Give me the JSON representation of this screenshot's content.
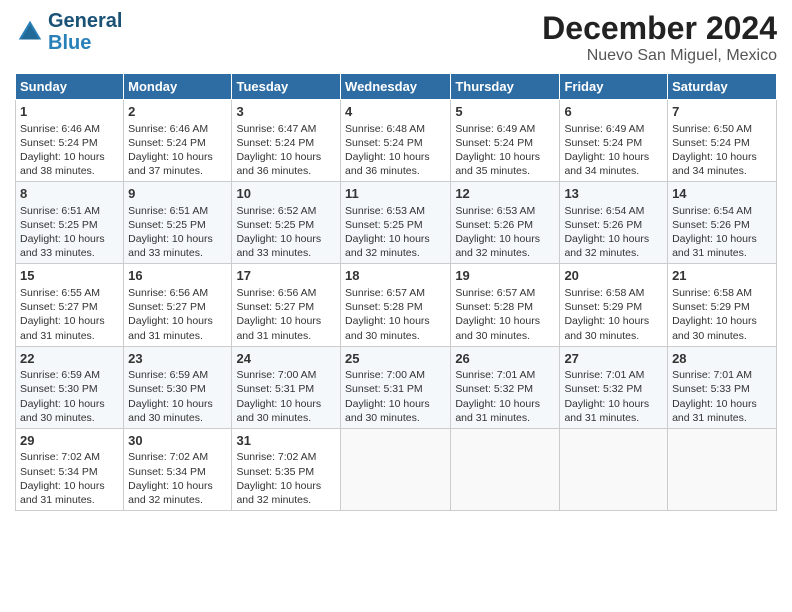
{
  "header": {
    "logo_line1": "General",
    "logo_line2": "Blue",
    "month": "December 2024",
    "location": "Nuevo San Miguel, Mexico"
  },
  "days_of_week": [
    "Sunday",
    "Monday",
    "Tuesday",
    "Wednesday",
    "Thursday",
    "Friday",
    "Saturday"
  ],
  "weeks": [
    [
      {
        "day": 1,
        "sunrise": "6:46 AM",
        "sunset": "5:24 PM",
        "daylight": "10 hours and 38 minutes."
      },
      {
        "day": 2,
        "sunrise": "6:46 AM",
        "sunset": "5:24 PM",
        "daylight": "10 hours and 37 minutes."
      },
      {
        "day": 3,
        "sunrise": "6:47 AM",
        "sunset": "5:24 PM",
        "daylight": "10 hours and 36 minutes."
      },
      {
        "day": 4,
        "sunrise": "6:48 AM",
        "sunset": "5:24 PM",
        "daylight": "10 hours and 36 minutes."
      },
      {
        "day": 5,
        "sunrise": "6:49 AM",
        "sunset": "5:24 PM",
        "daylight": "10 hours and 35 minutes."
      },
      {
        "day": 6,
        "sunrise": "6:49 AM",
        "sunset": "5:24 PM",
        "daylight": "10 hours and 34 minutes."
      },
      {
        "day": 7,
        "sunrise": "6:50 AM",
        "sunset": "5:24 PM",
        "daylight": "10 hours and 34 minutes."
      }
    ],
    [
      {
        "day": 8,
        "sunrise": "6:51 AM",
        "sunset": "5:25 PM",
        "daylight": "10 hours and 33 minutes."
      },
      {
        "day": 9,
        "sunrise": "6:51 AM",
        "sunset": "5:25 PM",
        "daylight": "10 hours and 33 minutes."
      },
      {
        "day": 10,
        "sunrise": "6:52 AM",
        "sunset": "5:25 PM",
        "daylight": "10 hours and 33 minutes."
      },
      {
        "day": 11,
        "sunrise": "6:53 AM",
        "sunset": "5:25 PM",
        "daylight": "10 hours and 32 minutes."
      },
      {
        "day": 12,
        "sunrise": "6:53 AM",
        "sunset": "5:26 PM",
        "daylight": "10 hours and 32 minutes."
      },
      {
        "day": 13,
        "sunrise": "6:54 AM",
        "sunset": "5:26 PM",
        "daylight": "10 hours and 32 minutes."
      },
      {
        "day": 14,
        "sunrise": "6:54 AM",
        "sunset": "5:26 PM",
        "daylight": "10 hours and 31 minutes."
      }
    ],
    [
      {
        "day": 15,
        "sunrise": "6:55 AM",
        "sunset": "5:27 PM",
        "daylight": "10 hours and 31 minutes."
      },
      {
        "day": 16,
        "sunrise": "6:56 AM",
        "sunset": "5:27 PM",
        "daylight": "10 hours and 31 minutes."
      },
      {
        "day": 17,
        "sunrise": "6:56 AM",
        "sunset": "5:27 PM",
        "daylight": "10 hours and 31 minutes."
      },
      {
        "day": 18,
        "sunrise": "6:57 AM",
        "sunset": "5:28 PM",
        "daylight": "10 hours and 30 minutes."
      },
      {
        "day": 19,
        "sunrise": "6:57 AM",
        "sunset": "5:28 PM",
        "daylight": "10 hours and 30 minutes."
      },
      {
        "day": 20,
        "sunrise": "6:58 AM",
        "sunset": "5:29 PM",
        "daylight": "10 hours and 30 minutes."
      },
      {
        "day": 21,
        "sunrise": "6:58 AM",
        "sunset": "5:29 PM",
        "daylight": "10 hours and 30 minutes."
      }
    ],
    [
      {
        "day": 22,
        "sunrise": "6:59 AM",
        "sunset": "5:30 PM",
        "daylight": "10 hours and 30 minutes."
      },
      {
        "day": 23,
        "sunrise": "6:59 AM",
        "sunset": "5:30 PM",
        "daylight": "10 hours and 30 minutes."
      },
      {
        "day": 24,
        "sunrise": "7:00 AM",
        "sunset": "5:31 PM",
        "daylight": "10 hours and 30 minutes."
      },
      {
        "day": 25,
        "sunrise": "7:00 AM",
        "sunset": "5:31 PM",
        "daylight": "10 hours and 30 minutes."
      },
      {
        "day": 26,
        "sunrise": "7:01 AM",
        "sunset": "5:32 PM",
        "daylight": "10 hours and 31 minutes."
      },
      {
        "day": 27,
        "sunrise": "7:01 AM",
        "sunset": "5:32 PM",
        "daylight": "10 hours and 31 minutes."
      },
      {
        "day": 28,
        "sunrise": "7:01 AM",
        "sunset": "5:33 PM",
        "daylight": "10 hours and 31 minutes."
      }
    ],
    [
      {
        "day": 29,
        "sunrise": "7:02 AM",
        "sunset": "5:34 PM",
        "daylight": "10 hours and 31 minutes."
      },
      {
        "day": 30,
        "sunrise": "7:02 AM",
        "sunset": "5:34 PM",
        "daylight": "10 hours and 32 minutes."
      },
      {
        "day": 31,
        "sunrise": "7:02 AM",
        "sunset": "5:35 PM",
        "daylight": "10 hours and 32 minutes."
      },
      null,
      null,
      null,
      null
    ]
  ]
}
